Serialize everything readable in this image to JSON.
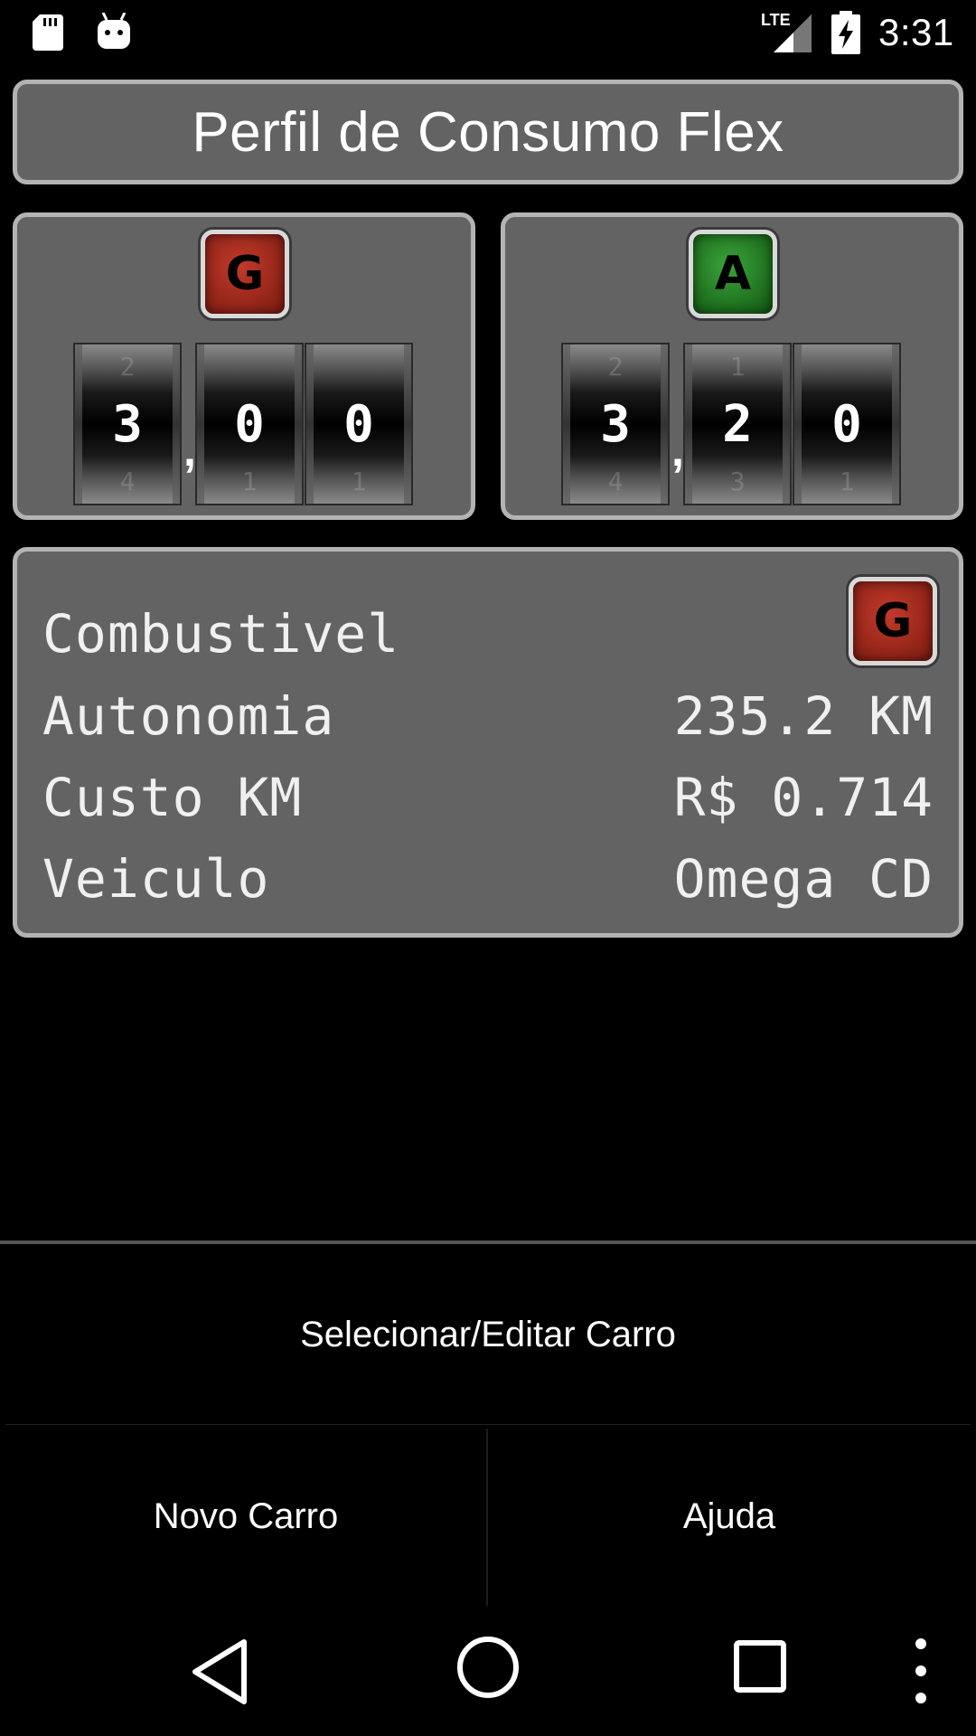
{
  "status_bar": {
    "time": "3:31",
    "network": "LTE",
    "icons": [
      "sd-card-icon",
      "android-debug-icon",
      "lte-signal-icon",
      "battery-charging-icon"
    ]
  },
  "header": {
    "title": "Perfil de Consumo Flex"
  },
  "prices": {
    "gasoline": {
      "badge": "G",
      "digit_1": "3",
      "digit_2": "0",
      "digit_3": "0",
      "ghost_above": [
        "2",
        "",
        ""
      ],
      "ghost_below": [
        "4",
        "1",
        "1"
      ]
    },
    "alcohol": {
      "badge": "A",
      "digit_1": "3",
      "digit_2": "2",
      "digit_3": "0",
      "ghost_above": [
        "2",
        "1",
        ""
      ],
      "ghost_below": [
        "4",
        "3",
        "1"
      ]
    },
    "separator": ","
  },
  "info": {
    "fuel_badge": "G",
    "rows": [
      {
        "label": "Combustivel",
        "value": ""
      },
      {
        "label": "Autonomia",
        "value": "235.2 KM"
      },
      {
        "label": "Custo KM",
        "value": "R$ 0.714"
      },
      {
        "label": "Veiculo",
        "value": "Omega CD"
      }
    ]
  },
  "menu": {
    "select_edit": "Selecionar/Editar Carro",
    "new_car": "Novo Carro",
    "help": "Ajuda"
  },
  "colors": {
    "panel_bg": "#636363",
    "panel_border": "#b3b3b3",
    "gasoline_badge": "#a32a1c",
    "alcohol_badge": "#2a7a2a"
  }
}
